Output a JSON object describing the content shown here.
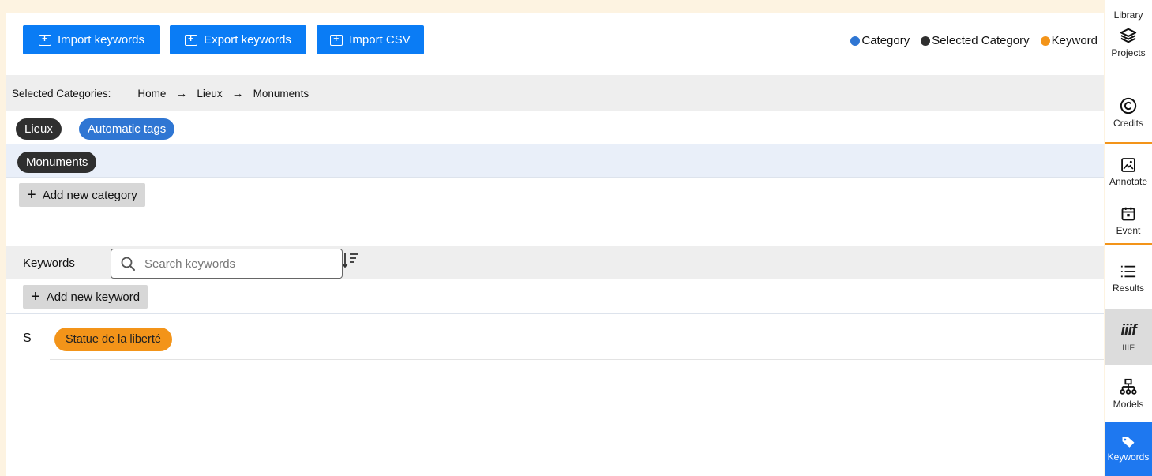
{
  "toolbar": {
    "import_keywords": "Import keywords",
    "export_keywords": "Export keywords",
    "import_csv": "Import CSV"
  },
  "legend": [
    {
      "label": "Category",
      "color": "#2f76d3"
    },
    {
      "label": "Selected Category",
      "color": "#2f2f2f"
    },
    {
      "label": "Keyword",
      "color": "#f39419"
    }
  ],
  "breadcrumb": {
    "label": "Selected Categories:",
    "items": [
      "Home",
      "Lieux",
      "Monuments"
    ]
  },
  "categories": {
    "row1": [
      "Lieux",
      "Automatic tags"
    ],
    "row2": [
      "Monuments"
    ],
    "add_label": "Add new category"
  },
  "keywords": {
    "label": "Keywords",
    "search_placeholder": "Search keywords",
    "add_label": "Add new keyword",
    "groups": [
      {
        "letter": "S",
        "items": [
          "Statue de la liberté"
        ]
      }
    ]
  },
  "sidebar": {
    "items": [
      {
        "label": "Library",
        "icon": "library-icon"
      },
      {
        "label": "Projects",
        "icon": "layers-icon"
      },
      {
        "label": "Credits",
        "icon": "copyright-icon"
      },
      {
        "label": "Annotate",
        "icon": "image-icon"
      },
      {
        "label": "Event",
        "icon": "calendar-icon"
      },
      {
        "label": "Results",
        "icon": "list-icon"
      },
      {
        "label": "IIIF",
        "icon": "iiif-icon"
      },
      {
        "label": "Models",
        "icon": "sitemap-icon"
      },
      {
        "label": "Keywords",
        "icon": "tag-icon"
      }
    ],
    "iiif_logo": "iiif",
    "accent_color": "#f39419",
    "active_color": "#1e78f0"
  }
}
